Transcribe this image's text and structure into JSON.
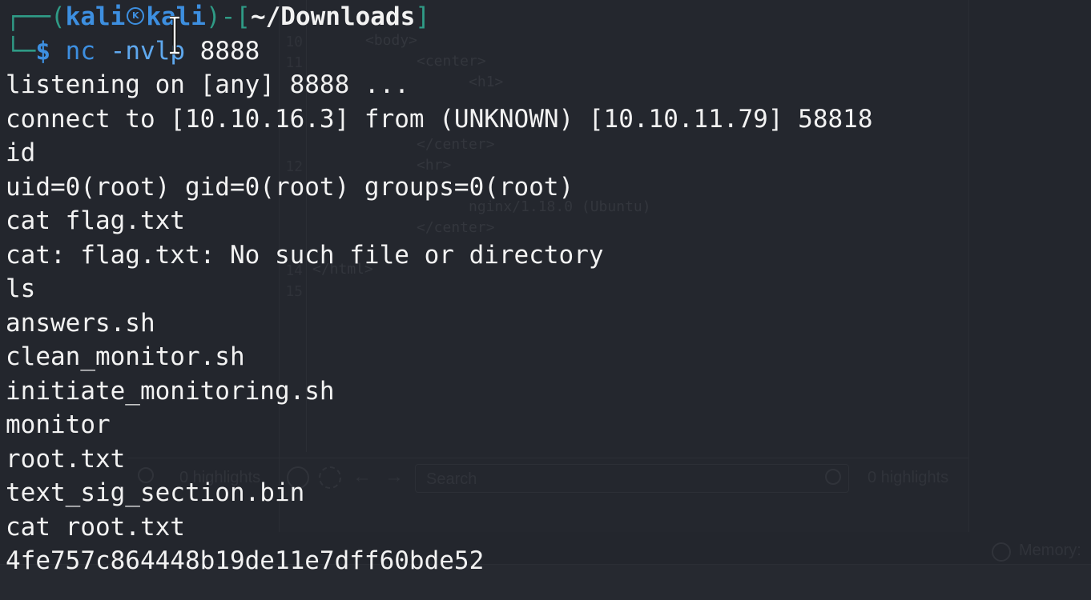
{
  "prompt": {
    "box_top": "┌──(",
    "user": "kali",
    "host": "kali",
    "sep": ")-[",
    "cwd": "~/Downloads",
    "close": "]",
    "box_bottom": "└─",
    "dollar": "$"
  },
  "command": {
    "program": "nc",
    "options": "-nvlp",
    "port": "8888"
  },
  "output_lines": [
    "listening on [any] 8888 ...",
    "connect to [10.10.16.3] from (UNKNOWN) [10.10.11.79] 58818",
    "id",
    "uid=0(root) gid=0(root) groups=0(root)",
    "cat flag.txt",
    "cat: flag.txt: No such file or directory",
    "ls",
    "answers.sh",
    "clean_monitor.sh",
    "initiate_monitoring.sh",
    "monitor",
    "root.txt",
    "text_sig_section.bin",
    "cat root.txt",
    "4fe757c864448b19de11e7dff60bde52"
  ],
  "background_window": {
    "code_lines": [
      "<body>",
      "<center>",
      "<h1>",
      "</center>",
      "<hr>",
      "nginx/1.18.0 (Ubuntu)",
      "</center>",
      "</html>"
    ],
    "line_numbers": [
      "10",
      "11",
      "12",
      "14",
      "15"
    ],
    "highlights_left": "0 highlights",
    "search_placeholder": "Search",
    "highlights_right": "0 highlights",
    "memory_label": "Memory:"
  },
  "icons": [
    "kali-dragon-icon",
    "text-cursor-icon",
    "help-icon",
    "gear-icon",
    "arrow-left-icon",
    "arrow-right-icon",
    "search-icon",
    "info-icon"
  ],
  "colors": {
    "background": "#23262d",
    "prompt_box": "#2f9b86",
    "prompt_user": "#3d8fe0",
    "text": "#f2f2f2"
  }
}
